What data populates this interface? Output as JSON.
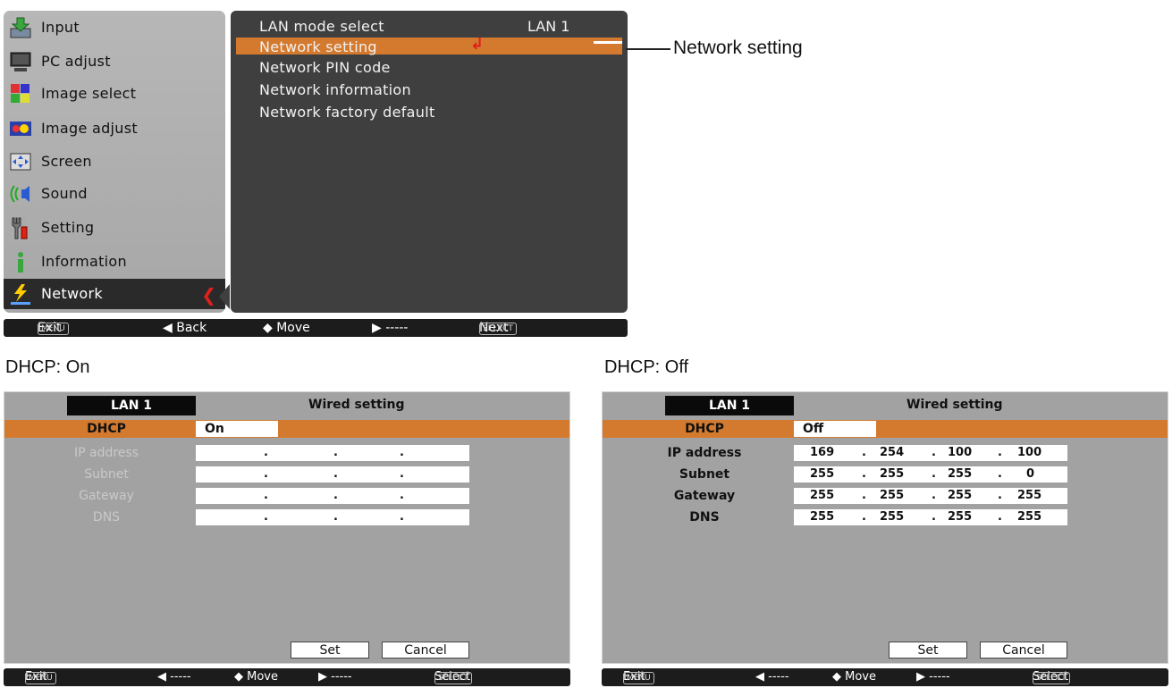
{
  "main_menu": {
    "items": [
      {
        "label": "Input",
        "icon": "input-icon"
      },
      {
        "label": "PC adjust",
        "icon": "pc-adjust-icon"
      },
      {
        "label": "Image select",
        "icon": "image-select-icon"
      },
      {
        "label": "Image adjust",
        "icon": "image-adjust-icon"
      },
      {
        "label": "Screen",
        "icon": "screen-icon"
      },
      {
        "label": "Sound",
        "icon": "sound-icon"
      },
      {
        "label": "Setting",
        "icon": "setting-icon"
      },
      {
        "label": "Information",
        "icon": "information-icon"
      },
      {
        "label": "Network",
        "icon": "network-icon"
      }
    ],
    "active_index": 8
  },
  "network_submenu": {
    "items": [
      {
        "label": "LAN mode select",
        "value": "LAN 1"
      },
      {
        "label": "Network setting"
      },
      {
        "label": "Network PIN code"
      },
      {
        "label": "Network information"
      },
      {
        "label": "Network factory default"
      }
    ],
    "selected_index": 1
  },
  "main_status": {
    "menu_key": "MENU",
    "exit": "Exit",
    "back": "◀ Back",
    "move": "◆ Move",
    "right": "▶ -----",
    "select_key": "SELECT",
    "next": "Next"
  },
  "callout": {
    "label": "Network setting"
  },
  "captions": {
    "on": "DHCP: On",
    "off": "DHCP: Off"
  },
  "panel_on": {
    "tab": "LAN 1",
    "title": "Wired setting",
    "dhcp_label": "DHCP",
    "dhcp_value": "On",
    "labels": {
      "ip": "IP address",
      "subnet": "Subnet",
      "gateway": "Gateway",
      "dns": "DNS"
    },
    "fields": {
      "ip": [
        "",
        "",
        "",
        ""
      ],
      "subnet": [
        "",
        "",
        "",
        ""
      ],
      "gateway": [
        "",
        "",
        "",
        ""
      ],
      "dns": [
        "",
        "",
        "",
        ""
      ]
    },
    "set": "Set",
    "cancel": "Cancel",
    "status": {
      "menu_key": "MENU",
      "exit": "Exit",
      "left": "◀ -----",
      "move": "◆ Move",
      "right": "▶ -----",
      "select_key": "SELECT",
      "select": "Select"
    }
  },
  "panel_off": {
    "tab": "LAN 1",
    "title": "Wired setting",
    "dhcp_label": "DHCP",
    "dhcp_value": "Off",
    "labels": {
      "ip": "IP address",
      "subnet": "Subnet",
      "gateway": "Gateway",
      "dns": "DNS"
    },
    "fields": {
      "ip": [
        "169",
        "254",
        "100",
        "100"
      ],
      "subnet": [
        "255",
        "255",
        "255",
        "0"
      ],
      "gateway": [
        "255",
        "255",
        "255",
        "255"
      ],
      "dns": [
        "255",
        "255",
        "255",
        "255"
      ]
    },
    "set": "Set",
    "cancel": "Cancel",
    "status": {
      "menu_key": "MENU",
      "exit": "Exit",
      "left": "◀ -----",
      "move": "◆ Move",
      "right": "▶ -----",
      "select_key": "SELECT",
      "select": "Select"
    }
  },
  "colors": {
    "highlight": "#d47a2f",
    "panel_dark": "#3f3f3f",
    "menu_bg": "#b0b0b0",
    "arrow_red": "#e0201c"
  }
}
